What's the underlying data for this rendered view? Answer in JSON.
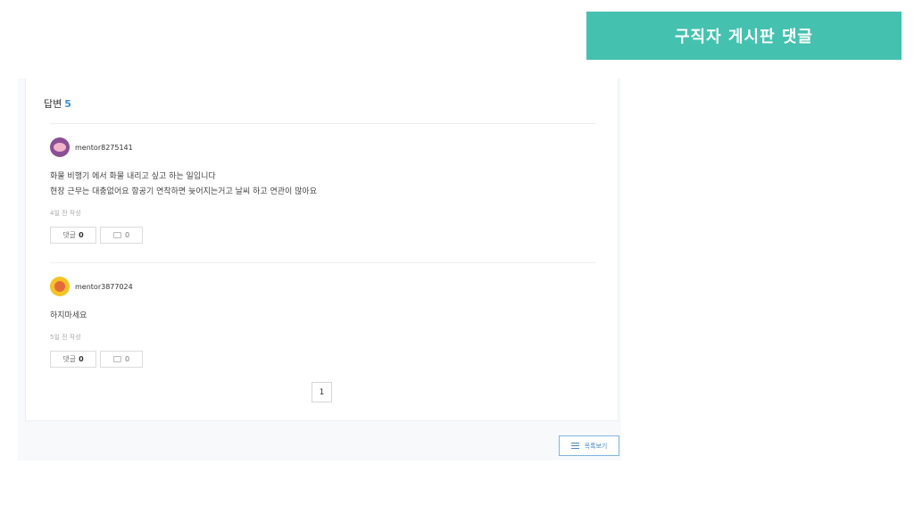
{
  "banner": {
    "title": "구직자 게시판 댓글"
  },
  "answers": {
    "label": "답변",
    "count": "5"
  },
  "comments": [
    {
      "author": "mentor8275141",
      "lines": [
        "화물 비행기 에서 화물 내리고 싶고 하는 일입니다",
        "현장 근무는 대충없어요 항공기 연착하면 늦어지는거고 날씨 하고 연관이 많아요"
      ],
      "time": "4일 전 작성",
      "reply_label": "댓글",
      "reply_count": "0",
      "like_count": "0"
    },
    {
      "author": "mentor3877024",
      "lines": [
        "하지마세요"
      ],
      "time": "5일 전 작성",
      "reply_label": "댓글",
      "reply_count": "0",
      "like_count": "0"
    }
  ],
  "pagination": {
    "current": "1"
  },
  "list_button": {
    "label": "목록보기"
  },
  "icons": {
    "avatar": "avatar-icon",
    "like": "thumbs-up-icon",
    "list": "list-icon"
  },
  "colors": {
    "banner": "#45c1af",
    "accent": "#3d8fd6"
  }
}
